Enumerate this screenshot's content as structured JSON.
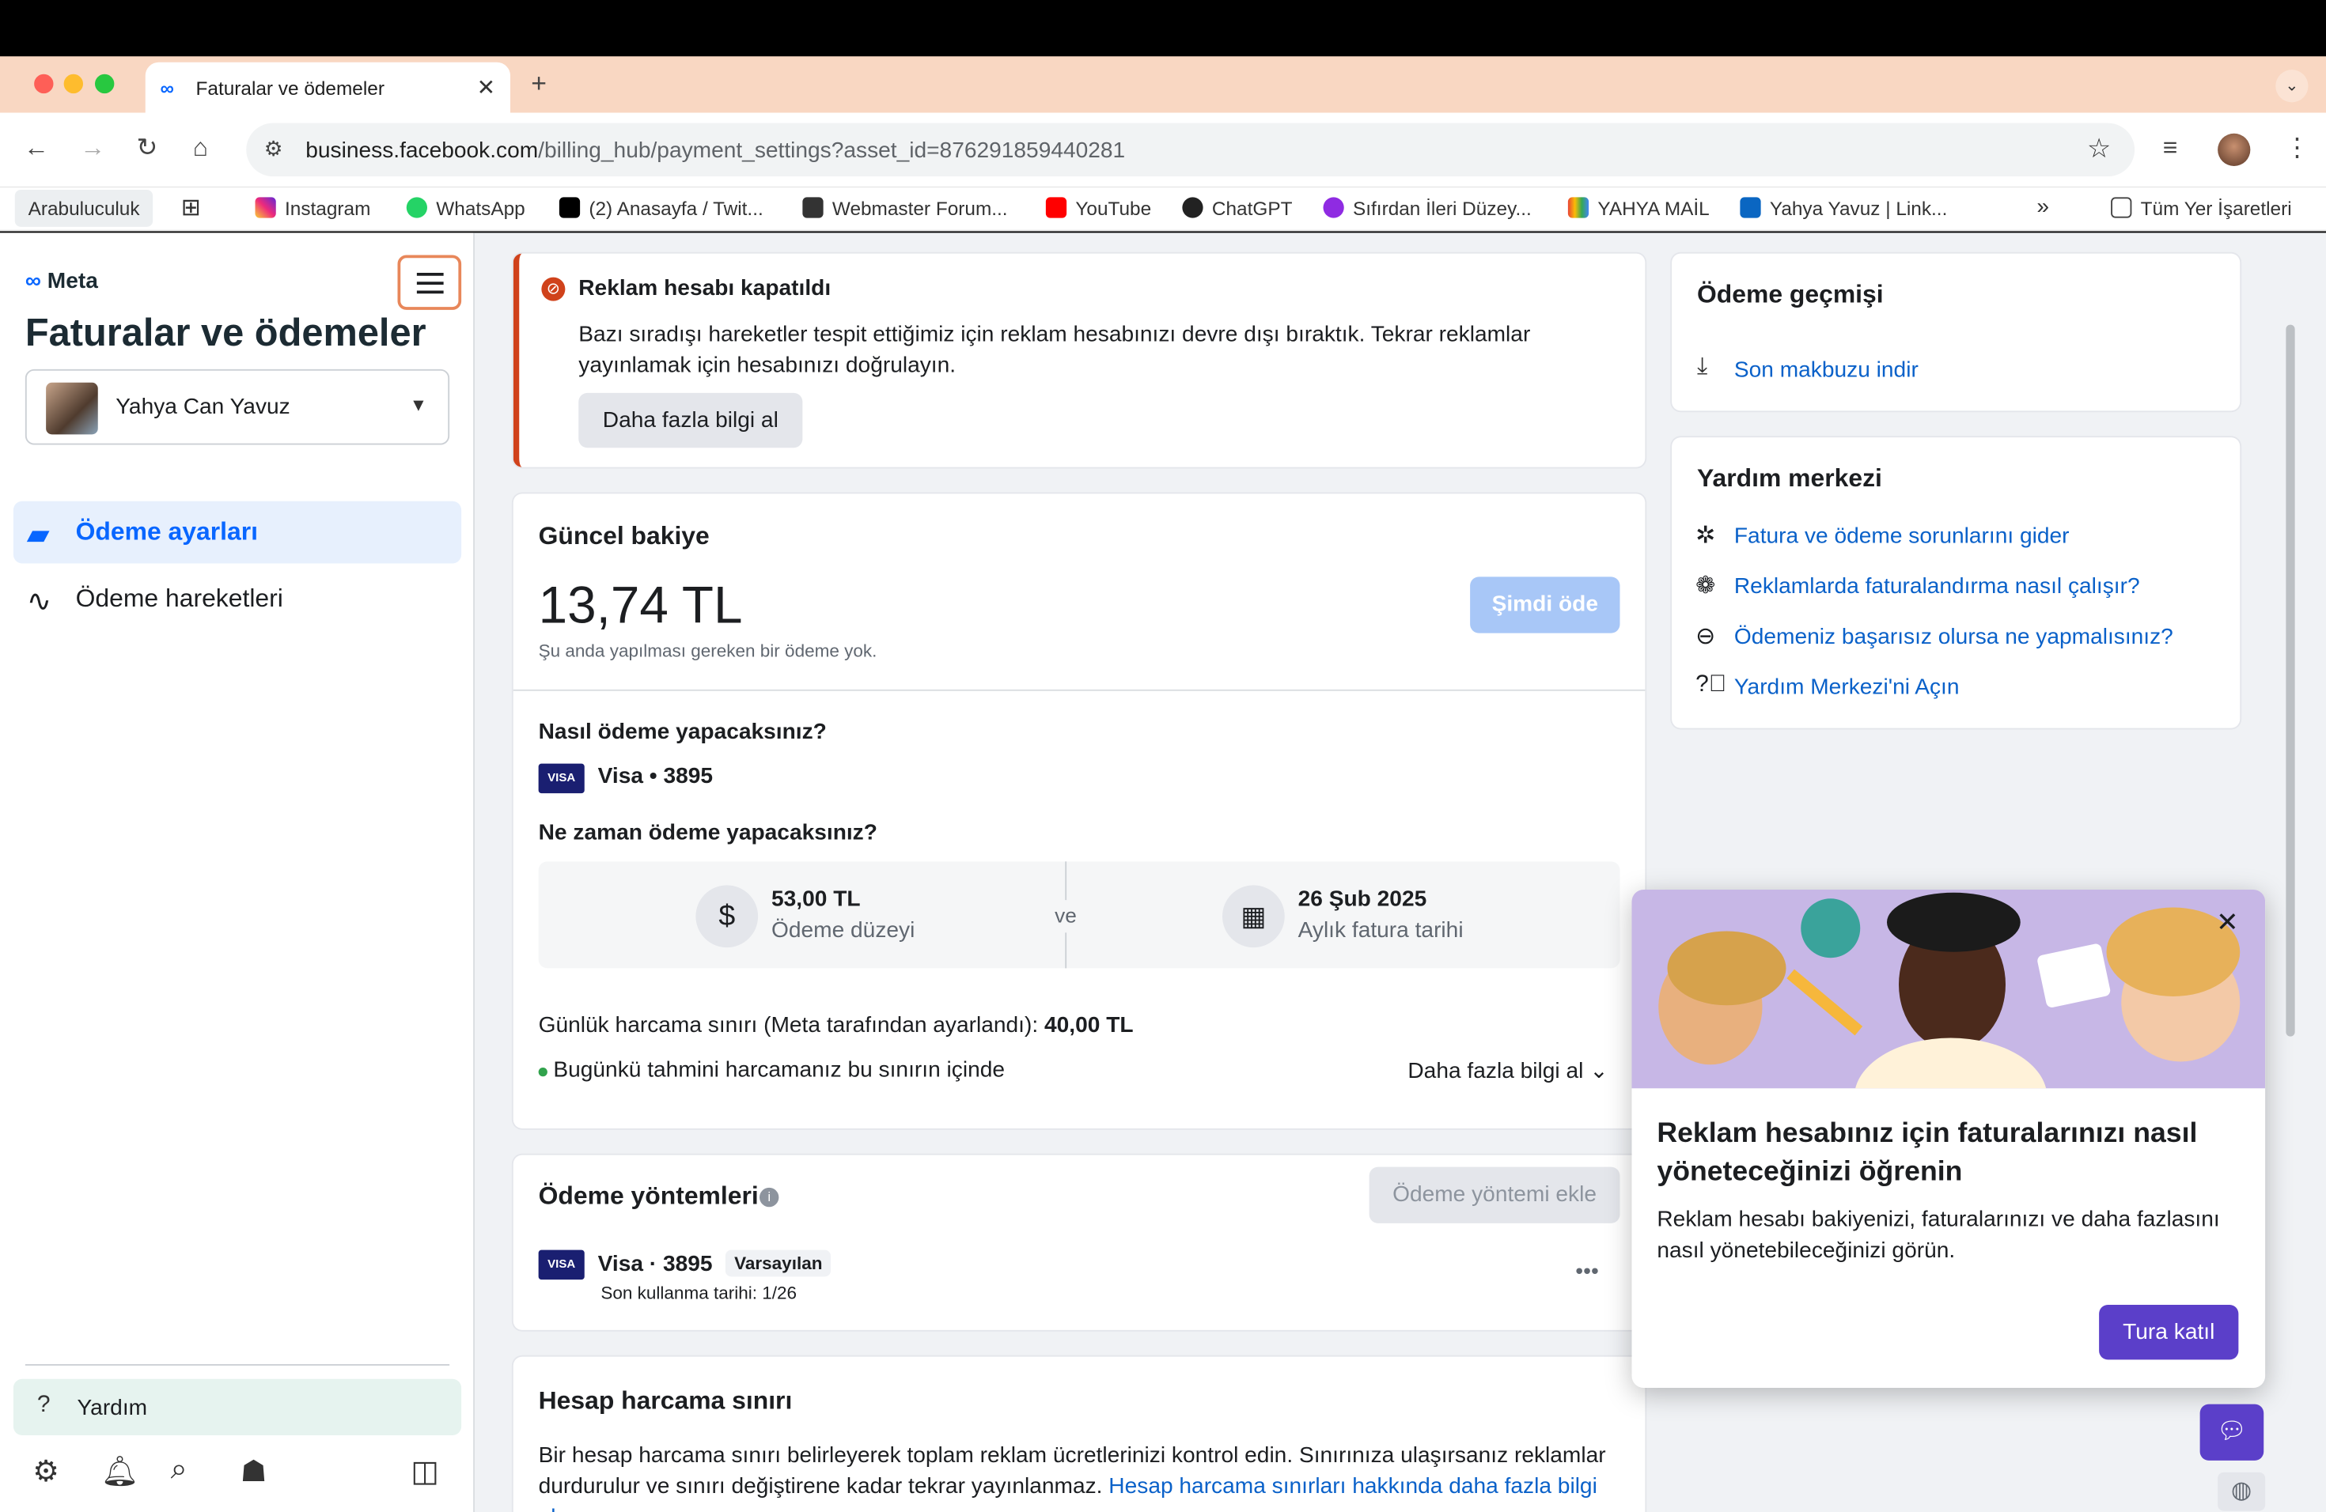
{
  "browser": {
    "tab_title": "Faturalar ve ödemeler",
    "url_host": "business.facebook.com",
    "url_path": "/billing_hub/payment_settings?asset_id=876291859440281",
    "bookmarks": [
      "Arabuluculuk",
      "Instagram",
      "WhatsApp",
      "(2) Anasayfa / Twit...",
      "Webmaster Forum...",
      "YouTube",
      "ChatGPT",
      "Sıfırdan İleri Düzey...",
      "YAHYA MAİL",
      "Yahya Yavuz | Link...",
      "Tüm Yer İşaretleri"
    ],
    "overflow": "»"
  },
  "sidebar": {
    "logo": "Meta",
    "page_title": "Faturalar ve ödemeler",
    "account_name": "Yahya Can Yavuz",
    "items": [
      "Ödeme ayarları",
      "Ödeme hareketleri"
    ],
    "help": "Yardım"
  },
  "alert": {
    "title": "Reklam hesabı kapatıldı",
    "body": "Bazı sıradışı hareketler tespit ettiğimiz için reklam hesabınızı devre dışı bıraktık. Tekrar reklamlar yayınlamak için hesabınızı doğrulayın.",
    "button": "Daha fazla bilgi al"
  },
  "balance": {
    "title": "Güncel bakiye",
    "amount": "13,74 TL",
    "note": "Şu anda yapılması gereken bir ödeme yok.",
    "pay_button": "Şimdi öde",
    "how_title": "Nasıl ödeme yapacaksınız?",
    "card": "Visa • 3895",
    "when_title": "Ne zaman ödeme yapacaksınız?",
    "threshold_value": "53,00 TL",
    "threshold_label": "Ödeme düzeyi",
    "and": "ve",
    "date_value": "26 Şub 2025",
    "date_label": "Aylık fatura tarihi",
    "daily_limit_label": "Günlük harcama sınırı (Meta tarafından ayarlandı):",
    "daily_limit_value": "40,00 TL",
    "status": "Bugünkü tahmini harcamanız bu sınırın içinde",
    "more": "Daha fazla bilgi al"
  },
  "methods": {
    "title": "Ödeme yöntemleri",
    "add_button": "Ödeme yöntemi ekle",
    "card": "Visa · 3895",
    "badge": "Varsayılan",
    "expiry": "Son kullanma tarihi: 1/26",
    "visa": "VISA"
  },
  "limit": {
    "title": "Hesap harcama sınırı",
    "body": "Bir hesap harcama sınırı belirleyerek toplam reklam ücretlerinizi kontrol edin. Sınırınıza ulaşırsanız reklamlar durdurulur ve sınırı değiştirene kadar tekrar yayınlanmaz.",
    "link": "Hesap harcama sınırları hakkında daha fazla bilgi alın"
  },
  "history": {
    "title": "Ödeme geçmişi",
    "link": "Son makbuzu indir"
  },
  "help_center": {
    "title": "Yardım merkezi",
    "links": [
      "Fatura ve ödeme sorunlarını gider",
      "Reklamlarda faturalandırma nasıl çalışır?",
      "Ödemeniz başarısız olursa ne yapmalısınız?",
      "Yardım Merkezi'ni Açın"
    ]
  },
  "tour": {
    "title": "Reklam hesabınız için faturalarınızı nasıl yöneteceğinizi öğrenin",
    "body": "Reklam hesabı bakiyenizi, faturalarınızı ve daha fazlasını nasıl yönetebileceğinizi görün.",
    "button": "Tura katıl"
  },
  "colors": {
    "accent": "#0866ff",
    "link": "#0a61c9",
    "alert": "#d0421b",
    "cta": "#5b3fc9",
    "tabbar": "#f9d7c2"
  }
}
